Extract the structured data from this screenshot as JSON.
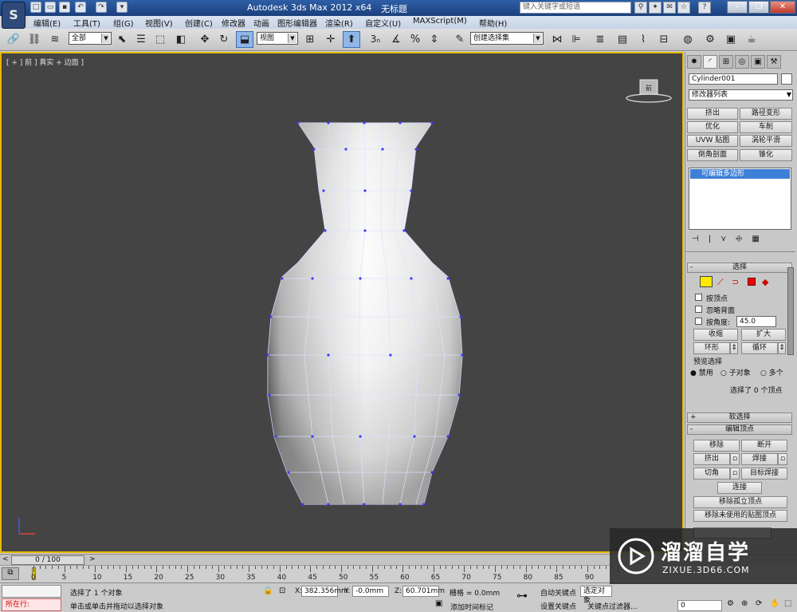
{
  "window": {
    "app_title": "Autodesk 3ds Max  2012 x64",
    "doc_title": "无标题",
    "search_placeholder": "键入关键字或短语"
  },
  "menu": [
    "编辑(E)",
    "工具(T)",
    "组(G)",
    "视图(V)",
    "创建(C)",
    "修改器",
    "动画",
    "图形编辑器",
    "渲染(R)",
    "自定义(U)",
    "MAXScript(M)",
    "帮助(H)"
  ],
  "toolbar": {
    "selection_filter": "全部",
    "ref_coord": "视图",
    "named_selection": "创建选择集",
    "snap_label": "3"
  },
  "viewport": {
    "label": "[ + ] 前 ] 真实 + 边面 ]",
    "viewcube_face": "前"
  },
  "command_panel": {
    "object_name": "Cylinder001",
    "modifier_list": "修改器列表",
    "mod_buttons": [
      "挤出",
      "路径变形",
      "优化",
      "车削",
      "UVW 贴图",
      "涡轮平滑",
      "倒角剖面",
      "锥化"
    ],
    "stack_item": "可编辑多边形",
    "selection": {
      "title": "选择",
      "by_vertex": "按顶点",
      "ignore_backfacing": "忽略背面",
      "by_angle": "按角度:",
      "angle_value": "45.0",
      "shrink": "收缩",
      "grow": "扩大",
      "ring": "环形",
      "loop": "循环",
      "preview_title": "预览选择",
      "preview_off": "禁用",
      "preview_sub": "子对象",
      "preview_multi": "多个",
      "status": "选择了 0 个顶点"
    },
    "soft_selection": "软选择",
    "edit_vertices": {
      "title": "编辑顶点",
      "remove": "移除",
      "break": "断开",
      "extrude": "挤出",
      "weld": "焊接",
      "chamfer": "切角",
      "target_weld": "目标焊接",
      "connect": "连接",
      "remove_isolated": "移除孤立顶点",
      "remove_unused_map": "移除未使用的贴图顶点"
    }
  },
  "timeline": {
    "frame": "0 / 100",
    "ticks": [
      "0",
      "5",
      "10",
      "15",
      "20",
      "25",
      "30",
      "35",
      "40",
      "45",
      "50",
      "55",
      "60",
      "65",
      "70",
      "75",
      "80",
      "85",
      "90"
    ]
  },
  "status": {
    "script_label": "所在行:",
    "selected": "选择了 1 个对象",
    "prompt": "单击或单击并拖动以选择对象",
    "x_value": "382.356mm",
    "y_value": "-0.0mm",
    "z_value": "60.701mm",
    "grid": "栅格 = 0.0mm",
    "add_time_tag": "添加时间标记",
    "auto_key": "自动关键点",
    "selected_object": "选定对象",
    "set_key": "设置关键点",
    "key_filters": "关键点过滤器...",
    "frame_value": "0"
  },
  "watermark": {
    "brand": "溜溜自学",
    "url": "ZIXUE.3D66.COM"
  }
}
